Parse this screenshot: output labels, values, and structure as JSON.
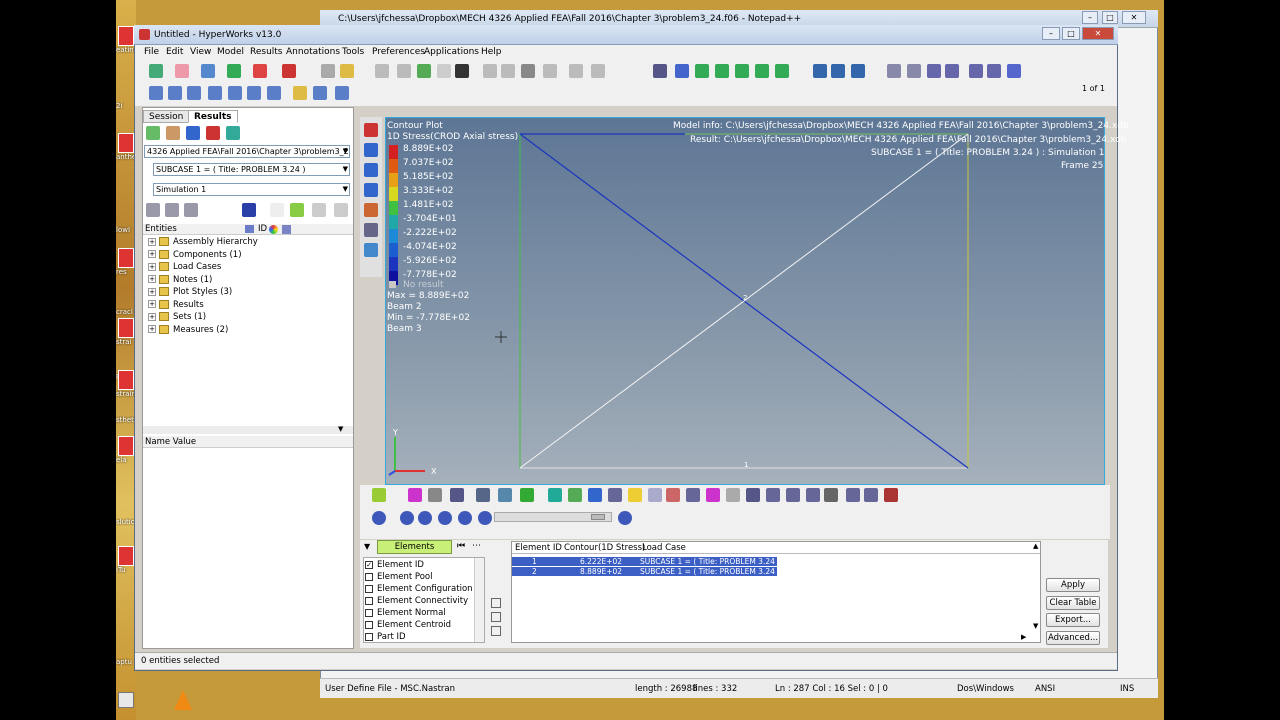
{
  "desktop": {
    "icon_labels": [
      "eatingInfo",
      "2i",
      "anthe",
      "lowI",
      "res",
      "cracl",
      "strai",
      "Pla",
      "strain",
      "stheti",
      "ela",
      "slutio",
      "iTu",
      "aptu"
    ]
  },
  "notepad": {
    "title": "C:\\Users\\jfchessa\\Dropbox\\MECH 4326 Applied FEA\\Fall 2016\\Chapter 3\\problem3_24.f06 - Notepad++",
    "status": {
      "filetype": "User Define File - MSC.Nastran",
      "length": "length : 26988",
      "lines": "lines : 332",
      "position": "Ln : 287   Col : 16   Sel : 0 | 0",
      "eol": "Dos\\Windows",
      "encoding": "ANSI",
      "mode": "INS"
    }
  },
  "hyperworks": {
    "title": "Untitled - HyperWorks v13.0",
    "menu": [
      "File",
      "Edit",
      "View",
      "Model",
      "Results",
      "Annotations",
      "Tools",
      "Preferences",
      "Applications",
      "Help"
    ],
    "page_indicator": "1 of 1",
    "tabs": {
      "session": "Session",
      "results": "Results"
    },
    "file_combo": "4326 Applied FEA\\Fall 2016\\Chapter 3\\problem3_24.xdb",
    "subcase_combo": "SUBCASE 1 = ( Title: PROBLEM 3.24 )",
    "simulation_combo": "Simulation 1",
    "entities_header": "Entities",
    "entities_id": "ID",
    "tree": [
      {
        "label": "Assembly Hierarchy",
        "expanded": false
      },
      {
        "label": "Components (1)",
        "expanded": true
      },
      {
        "label": "Load Cases",
        "expanded": true
      },
      {
        "label": "Notes (1)",
        "expanded": true
      },
      {
        "label": "Plot Styles (3)",
        "expanded": true
      },
      {
        "label": "Results",
        "expanded": false
      },
      {
        "label": "Sets (1)",
        "expanded": true
      },
      {
        "label": "Measures (2)",
        "expanded": true
      }
    ],
    "name_value_header": "Name Value",
    "status": "0 entities selected"
  },
  "viewport": {
    "plot_title": "Contour Plot",
    "plot_subtitle": "1D Stress(CROD Axial stress)",
    "legend": [
      {
        "value": "8.889E+02",
        "color": "#d42020"
      },
      {
        "value": "7.037E+02",
        "color": "#e05a10"
      },
      {
        "value": "5.185E+02",
        "color": "#e8a018"
      },
      {
        "value": "3.333E+02",
        "color": "#d8d820"
      },
      {
        "value": "1.481E+02",
        "color": "#40c040"
      },
      {
        "value": "-3.704E+01",
        "color": "#20a8a8"
      },
      {
        "value": "-2.222E+02",
        "color": "#1c8ad6"
      },
      {
        "value": "-4.074E+02",
        "color": "#1a5ed0"
      },
      {
        "value": "-5.926E+02",
        "color": "#1a34c0"
      },
      {
        "value": "-7.778E+02",
        "color": "#1010a0"
      }
    ],
    "no_result": "No result",
    "max_label": "Max = 8.889E+02",
    "max_elem": "Beam 2",
    "min_label": "Min = -7.778E+02",
    "min_elem": "Beam 3",
    "model_info": "Model info: C:\\Users\\jfchessa\\Dropbox\\MECH 4326 Applied FEA\\Fall 2016\\Chapter 3\\problem3_24.xdb",
    "result_info": "Result: C:\\Users\\jfchessa\\Dropbox\\MECH 4326 Applied FEA\\Fall 2016\\Chapter 3\\problem3_24.xdb",
    "subcase_info": "SUBCASE 1 = ( Title: PROBLEM 3.24 )  : Simulation 1",
    "frame_info": "Frame 25",
    "axis_x": "X",
    "axis_y": "Y",
    "node_label_center": "2",
    "node_label_bottom": "1"
  },
  "query": {
    "selector": "Elements",
    "options": [
      {
        "label": "Element ID",
        "checked": true
      },
      {
        "label": "Element Pool",
        "checked": false
      },
      {
        "label": "Element Configuration",
        "checked": false
      },
      {
        "label": "Element Connectivity",
        "checked": false
      },
      {
        "label": "Element Normal",
        "checked": false
      },
      {
        "label": "Element Centroid",
        "checked": false
      },
      {
        "label": "Part ID",
        "checked": false
      }
    ],
    "columns": [
      "Element ID",
      "Contour(1D Stress)",
      "Load Case"
    ],
    "rows": [
      {
        "id": "1",
        "value": "6.222E+02",
        "case": "SUBCASE 1 = ( Title: PROBLEM 3.24 )"
      },
      {
        "id": "2",
        "value": "8.889E+02",
        "case": "SUBCASE 1 = ( Title: PROBLEM 3.24 )"
      }
    ],
    "buttons": {
      "apply": "Apply",
      "clear": "Clear Table",
      "export": "Export...",
      "advanced": "Advanced..."
    }
  },
  "colors": {
    "viewport_border": "#33aadd",
    "selected_row": "#3b5fc4",
    "elements_tab": "#c8f078"
  }
}
